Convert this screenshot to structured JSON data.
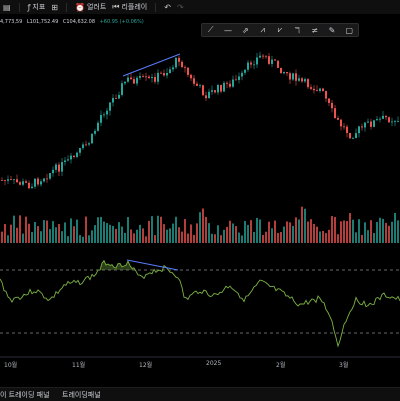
{
  "toolbar": {
    "indicators_label": "지표",
    "alert_label": "얼러트",
    "replay_label": "리플레이",
    "undo_icon": "undo-icon",
    "redo_icon": "redo-icon"
  },
  "ohlc": {
    "prefix": "4,773,59",
    "low_text": "L101,752.49",
    "close_text": "C104,632.08",
    "change_text": "+60.95 (+0.06%)"
  },
  "drawing_toolbar": {
    "tools": [
      "trend-line-icon",
      "horizontal-line-icon",
      "arrow-icon",
      "zigzag-icon",
      "pattern-icon",
      "text-icon",
      "measure-icon",
      "eye-icon",
      "rectangle-icon"
    ],
    "glyphs": [
      "⟋",
      "—",
      "⇗",
      "⩘",
      "⩗",
      "ℸ",
      "≠",
      "✎",
      "▢"
    ]
  },
  "x_axis_labels": [
    "10월",
    "11월",
    "12월",
    "2025",
    "2월",
    "3월"
  ],
  "bottom_tabs": [
    "이 트레이딩 패널",
    "트레이딩패널"
  ],
  "colors": {
    "bull": "#26a69a",
    "bear": "#ef5350",
    "osc": "#7cb342",
    "trendline": "#5b7cfa"
  },
  "chart_data": {
    "type": "candlestick",
    "x_labels": [
      "10월",
      "11월",
      "12월",
      "2025",
      "2월",
      "3월"
    ],
    "indicator": "oscillator with two horizontal dashed threshold lines",
    "annotations": [
      "bearish divergence trendline on price (Nov–Dec)",
      "bearish divergence trendline on oscillator (Nov–Dec)"
    ]
  }
}
